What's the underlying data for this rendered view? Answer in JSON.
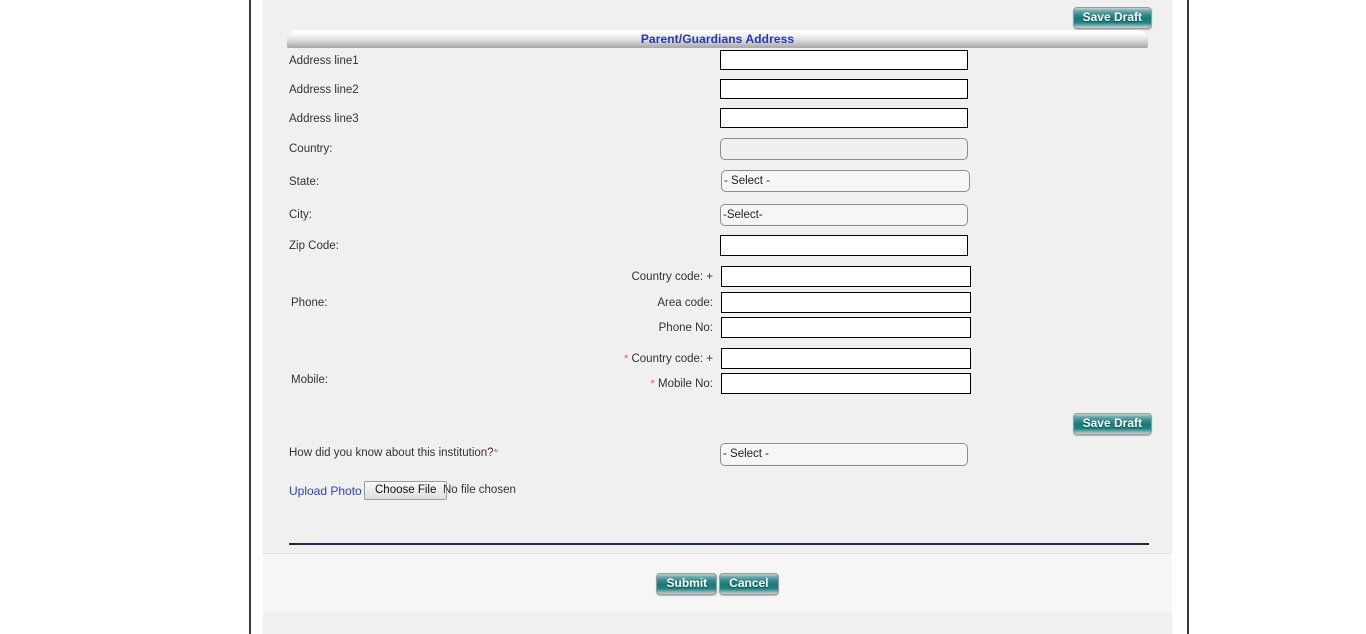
{
  "section": {
    "title": "Parent/Guardians Address"
  },
  "toolbar": {
    "save_draft_top": "Save Draft",
    "save_draft_mid": "Save Draft"
  },
  "fields": {
    "address_line1": {
      "label": "Address line1",
      "value": "",
      "type": "text"
    },
    "address_line2": {
      "label": "Address line2",
      "value": "",
      "type": "text"
    },
    "address_line3": {
      "label": "Address line3",
      "value": "",
      "type": "text"
    },
    "country": {
      "label": "Country:",
      "value": "",
      "type": "select",
      "disabled": true
    },
    "state": {
      "label": "State:",
      "value": "- Select -",
      "type": "select"
    },
    "city": {
      "label": "City:",
      "value": "-Select-",
      "type": "select"
    },
    "zip_code": {
      "label": "Zip Code:",
      "value": "",
      "type": "text"
    }
  },
  "phone": {
    "group_label": "Phone:",
    "country_code": {
      "label": "Country code: +",
      "value": "",
      "required": false
    },
    "area_code": {
      "label": "Area code:",
      "value": "",
      "required": false
    },
    "phone_no": {
      "label": "Phone No:",
      "value": "",
      "required": false
    }
  },
  "mobile": {
    "group_label": "Mobile:",
    "required_marker": "*",
    "country_code": {
      "label": "Country code: +",
      "value": "",
      "required": true
    },
    "mobile_no": {
      "label": "Mobile No:",
      "value": "",
      "required": true
    }
  },
  "referral": {
    "label": "How did you know about this institution?",
    "required_marker": "*",
    "value": "- Select -"
  },
  "upload": {
    "link_label": "Upload Photo",
    "button_label": "Choose File",
    "status": "No file chosen"
  },
  "footer": {
    "submit_label": "Submit",
    "cancel_label": "Cancel"
  },
  "colors": {
    "accent_blue": "#1f35cc",
    "link_blue": "#2b45c9",
    "button_teal": "#157a7a",
    "required_red": "#e05a7a",
    "panel_bg": "#f0f0f0",
    "divider": "#1b2a47"
  }
}
